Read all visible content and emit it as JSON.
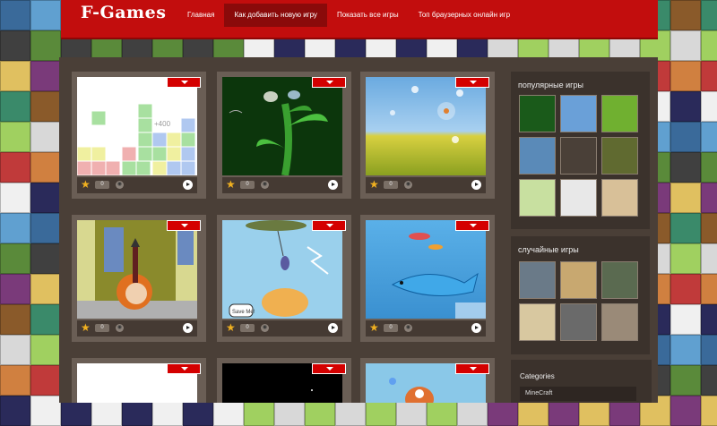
{
  "site": {
    "logo": "F-Games"
  },
  "nav": [
    {
      "label": "Главная",
      "active": false
    },
    {
      "label": "Как добавить новую игру",
      "active": true
    },
    {
      "label": "Показать все игры",
      "active": false
    },
    {
      "label": "Топ браузерных онлайн игр",
      "active": false
    }
  ],
  "sidebar": {
    "popular_title": "популярные игры",
    "random_title": "случайные игры",
    "categories_title": "Categories",
    "categories": [
      "MineCraft"
    ]
  },
  "game_card": {
    "score_text": "+400",
    "speech_text": "Save Me!",
    "count": "0"
  },
  "colors": {
    "header_red": "#c20d0d",
    "content_bg": "#4a3f37",
    "card_frame": "#6a5e55",
    "sidebar_bg": "#3b322c"
  }
}
